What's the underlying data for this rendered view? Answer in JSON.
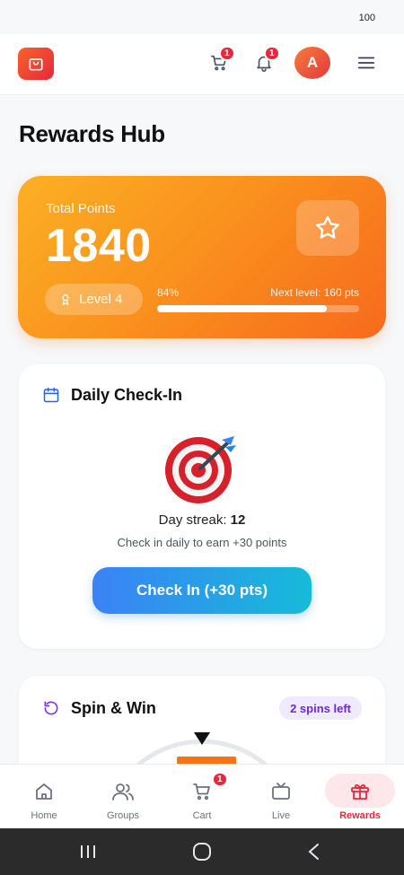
{
  "status_bar": {
    "battery": "100"
  },
  "header": {
    "cart_badge": "1",
    "notifications_badge": "1",
    "avatar_initial": "A"
  },
  "page": {
    "title": "Rewards Hub"
  },
  "points_card": {
    "label": "Total Points",
    "value": "1840",
    "level": "Level 4",
    "progress_text": "84%",
    "progress_fraction": 0.84,
    "next_level": "Next level: 160 pts"
  },
  "daily_checkin": {
    "title": "Daily Check-In",
    "streak_label": "Day streak:",
    "streak_value": "12",
    "subtitle": "Check in daily to earn +30 points",
    "button_label": "Check In (+30 pts)"
  },
  "spin_win": {
    "title": "Spin & Win",
    "spins_left": "2 spins left"
  },
  "bottom_nav": {
    "items": [
      {
        "label": "Home",
        "icon": "home-icon"
      },
      {
        "label": "Groups",
        "icon": "groups-icon"
      },
      {
        "label": "Cart",
        "icon": "cart-icon",
        "badge": "1"
      },
      {
        "label": "Live",
        "icon": "tv-icon"
      },
      {
        "label": "Rewards",
        "icon": "gift-icon",
        "active": true
      }
    ]
  },
  "colors": {
    "accent_red": "#e5283b",
    "points_gradient_start": "#fbb024",
    "points_gradient_end": "#f76a1d",
    "checkin_gradient_start": "#3b82f6",
    "checkin_gradient_end": "#16bbd9",
    "spins_purple": "#6d28d9"
  }
}
